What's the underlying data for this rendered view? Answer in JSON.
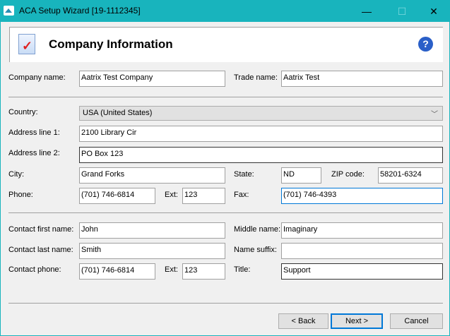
{
  "window": {
    "title": "ACA Setup Wizard [19-1112345]",
    "minimize": "—",
    "maximize": "☐",
    "close": "✕"
  },
  "header": {
    "title": "Company Information",
    "help": "?"
  },
  "company": {
    "name_label": "Company name:",
    "name": "Aatrix Test Company",
    "trade_label": "Trade name:",
    "trade": "Aatrix Test"
  },
  "address": {
    "country_label": "Country:",
    "country": "USA (United States)",
    "line1_label": "Address line 1:",
    "line1": "2100 Library Cir",
    "line2_label": "Address line 2:",
    "line2": "PO Box 123",
    "city_label": "City:",
    "city": "Grand Forks",
    "state_label": "State:",
    "state": "ND",
    "zip_label": "ZIP code:",
    "zip": "58201-6324",
    "phone_label": "Phone:",
    "phone": "(701) 746-6814",
    "ext_label": "Ext:",
    "ext": "123",
    "fax_label": "Fax:",
    "fax": "(701) 746-4393"
  },
  "contact": {
    "first_label": "Contact first name:",
    "first": "John",
    "middle_label": "Middle name:",
    "middle": "Imaginary",
    "last_label": "Contact last name:",
    "last": "Smith",
    "suffix_label": "Name suffix:",
    "suffix": "",
    "phone_label": "Contact phone:",
    "phone": "(701) 746-6814",
    "ext_label": "Ext:",
    "ext": "123",
    "title_label": "Title:",
    "title": "Support"
  },
  "buttons": {
    "back": "< Back",
    "next": "Next >",
    "cancel": "Cancel"
  }
}
